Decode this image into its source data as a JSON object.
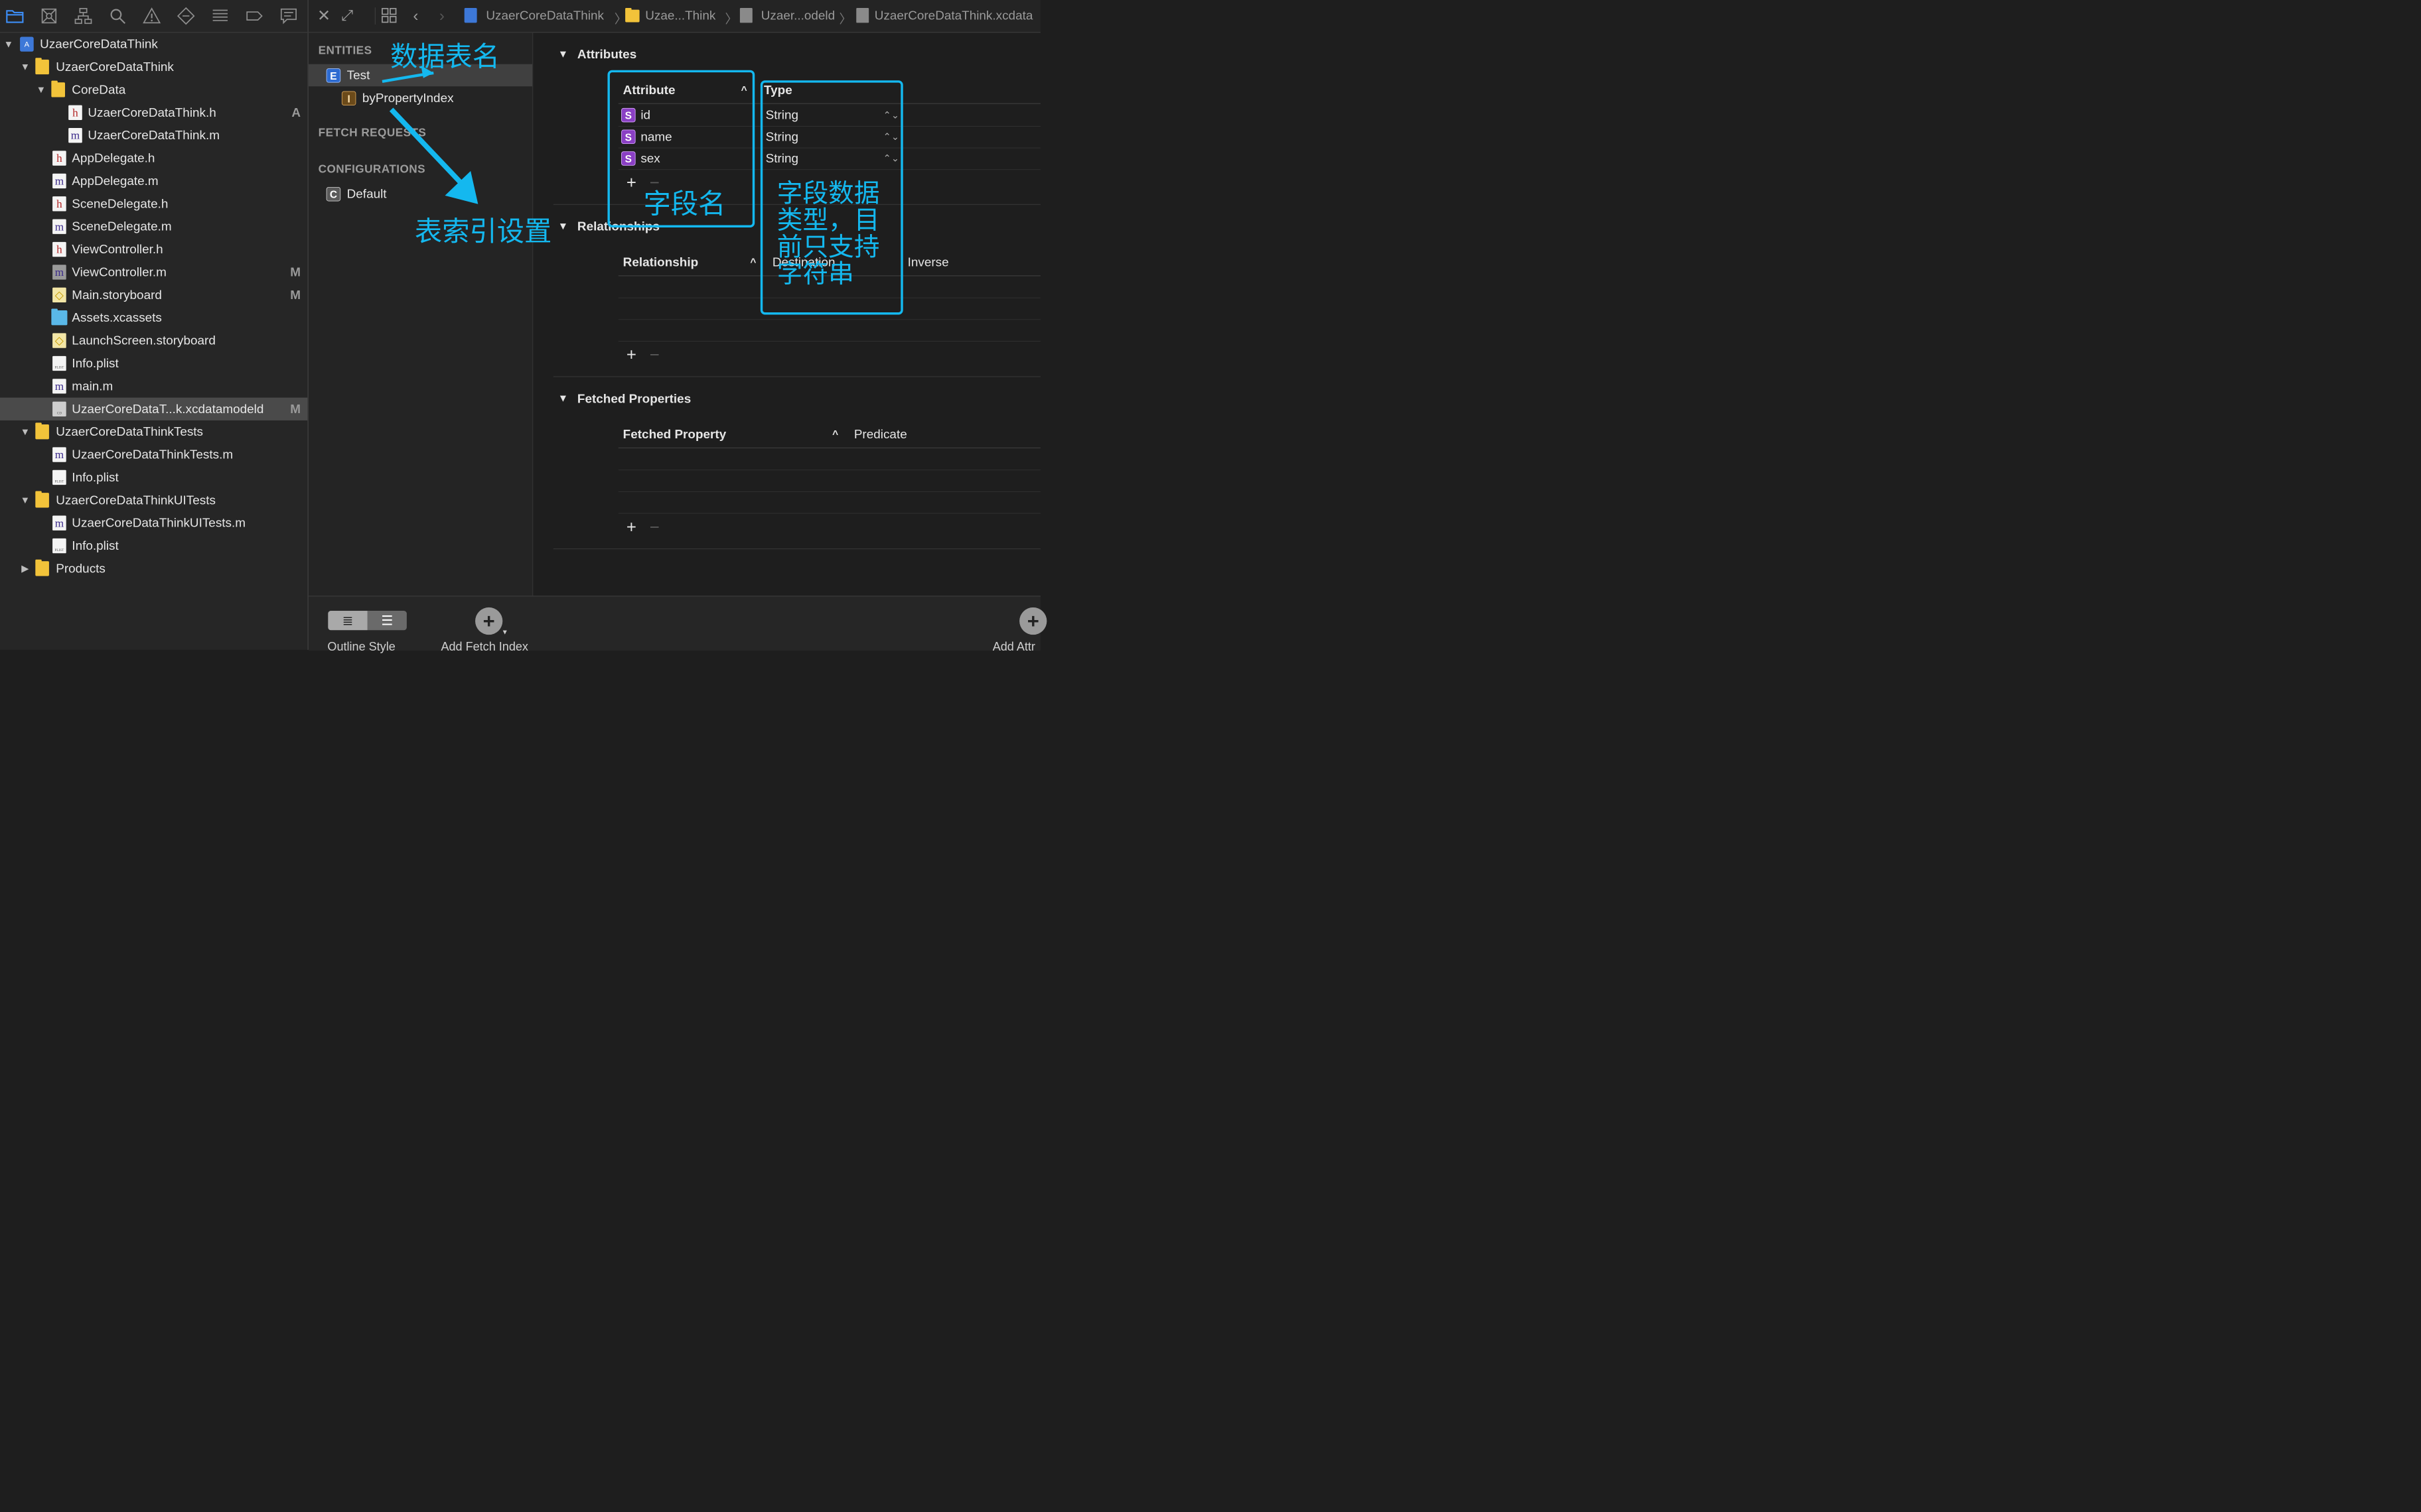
{
  "colors": {
    "accent": "#3d8ef7",
    "annotation": "#14b8ef",
    "selected_row": "#4a4a4a"
  },
  "navigator_toolbar": {
    "icons": [
      "folder-icon",
      "source-control-icon",
      "symbol-hierarchy-icon",
      "find-icon",
      "issue-warning-icon",
      "test-diamond-icon",
      "debug-list-icon",
      "breakpoint-icon",
      "report-icon"
    ]
  },
  "tree": {
    "project": {
      "label": "UzaerCoreDataThink"
    },
    "group_main": {
      "label": "UzaerCoreDataThink"
    },
    "group_coredata": {
      "label": "CoreData"
    },
    "file_cd_h": {
      "label": "UzaerCoreDataThink.h",
      "badge": "A"
    },
    "file_cd_m": {
      "label": "UzaerCoreDataThink.m"
    },
    "file_appdelegate_h": {
      "label": "AppDelegate.h"
    },
    "file_appdelegate_m": {
      "label": "AppDelegate.m"
    },
    "file_scenedelegate_h": {
      "label": "SceneDelegate.h"
    },
    "file_scenedelegate_m": {
      "label": "SceneDelegate.m"
    },
    "file_viewcontroller_h": {
      "label": "ViewController.h"
    },
    "file_viewcontroller_m": {
      "label": "ViewController.m",
      "badge": "M"
    },
    "file_main_storyboard": {
      "label": "Main.storyboard",
      "badge": "M"
    },
    "file_assets": {
      "label": "Assets.xcassets"
    },
    "file_launchscreen": {
      "label": "LaunchScreen.storyboard"
    },
    "file_info_plist": {
      "label": "Info.plist"
    },
    "file_main_m": {
      "label": "main.m"
    },
    "file_xcdatamodel": {
      "label": "UzaerCoreDataT...k.xcdatamodeld",
      "badge": "M"
    },
    "group_tests": {
      "label": "UzaerCoreDataThinkTests"
    },
    "file_tests_m": {
      "label": "UzaerCoreDataThinkTests.m"
    },
    "file_tests_plist": {
      "label": "Info.plist"
    },
    "group_uitests": {
      "label": "UzaerCoreDataThinkUITests"
    },
    "file_uitests_m": {
      "label": "UzaerCoreDataThinkUITests.m"
    },
    "file_uitests_plist": {
      "label": "Info.plist"
    },
    "group_products": {
      "label": "Products"
    }
  },
  "jumpbar": {
    "crumbs": [
      "UzaerCoreDataThink",
      "Uzae...Think",
      "Uzaer...odeld",
      "UzaerCoreDataThink.xcdata"
    ]
  },
  "entities_panel": {
    "entities_header": "ENTITIES",
    "entity_name": "Test",
    "entity_tag": "E",
    "index_name": "byPropertyIndex",
    "index_tag": "I",
    "fetch_requests_header": "FETCH REQUESTS",
    "configurations_header": "CONFIGURATIONS",
    "configuration_name": "Default",
    "configuration_tag": "C"
  },
  "attributes": {
    "title": "Attributes",
    "col_attribute": "Attribute",
    "col_type": "Type",
    "rows": [
      {
        "tag": "S",
        "name": "id",
        "type": "String"
      },
      {
        "tag": "S",
        "name": "name",
        "type": "String"
      },
      {
        "tag": "S",
        "name": "sex",
        "type": "String"
      }
    ]
  },
  "relationships": {
    "title": "Relationships",
    "col_relationship": "Relationship",
    "col_destination": "Destination",
    "col_inverse": "Inverse"
  },
  "fetched_properties": {
    "title": "Fetched Properties",
    "col_fetched_property": "Fetched Property",
    "col_predicate": "Predicate"
  },
  "bottom_bar": {
    "outline_style_label": "Outline Style",
    "add_fetch_index_label": "Add Fetch Index",
    "add_attribute_label": "Add Attr"
  },
  "annotations": {
    "table_name": "数据表名",
    "index_setting": "表索引设置",
    "field_name": "字段名",
    "field_type_lines": [
      "字段数据",
      "类型，目",
      "前只支持",
      "字符串"
    ]
  }
}
